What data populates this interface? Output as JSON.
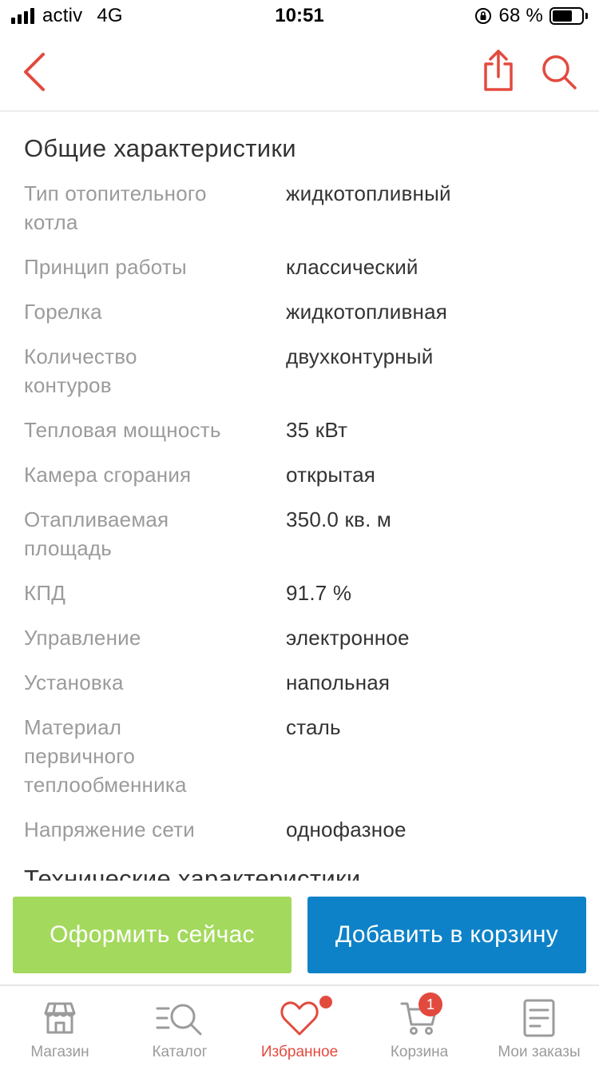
{
  "status_bar": {
    "carrier": "activ",
    "network": "4G",
    "time": "10:51",
    "battery_percent": "68 %",
    "battery_level": 0.68
  },
  "header": {
    "back_icon": "chevron-left-icon",
    "share_icon": "share-icon",
    "search_icon": "search-icon",
    "accent_color": "#e24a3e"
  },
  "sections": [
    {
      "title": "Общие характеристики",
      "specs": [
        {
          "name": "Тип отопительного котла",
          "value": "жидкотопливный"
        },
        {
          "name": "Принцип работы",
          "value": "классический"
        },
        {
          "name": "Горелка",
          "value": "жидкотопливная"
        },
        {
          "name": "Количество контуров",
          "value": "двухконтурный"
        },
        {
          "name": "Тепловая мощность",
          "value": "35 кВт"
        },
        {
          "name": "Камера сгорания",
          "value": "открытая"
        },
        {
          "name": "Отапливаемая площадь",
          "value": "350.0 кв. м"
        },
        {
          "name": "КПД",
          "value": "91.7 %"
        },
        {
          "name": "Управление",
          "value": "электронное"
        },
        {
          "name": "Установка",
          "value": "напольная"
        },
        {
          "name": "Материал первичного теплообменника",
          "value": "сталь"
        },
        {
          "name": "Напряжение сети",
          "value": "однофазное"
        }
      ]
    },
    {
      "title": "Технические характеристики",
      "specs": []
    }
  ],
  "actions": {
    "buy_now_label": "Оформить сейчас",
    "add_to_cart_label": "Добавить в корзину",
    "buy_now_color": "#a3d95c",
    "add_to_cart_color": "#0d82c8"
  },
  "bottom_nav": {
    "items": [
      {
        "label": "Магазин",
        "icon": "store-icon",
        "active": false
      },
      {
        "label": "Каталог",
        "icon": "catalog-search-icon",
        "active": false
      },
      {
        "label": "Избранное",
        "icon": "heart-icon",
        "active": true
      },
      {
        "label": "Корзина",
        "icon": "cart-icon",
        "active": false,
        "badge": "1"
      },
      {
        "label": "Мои заказы",
        "icon": "orders-icon",
        "active": false
      }
    ]
  }
}
